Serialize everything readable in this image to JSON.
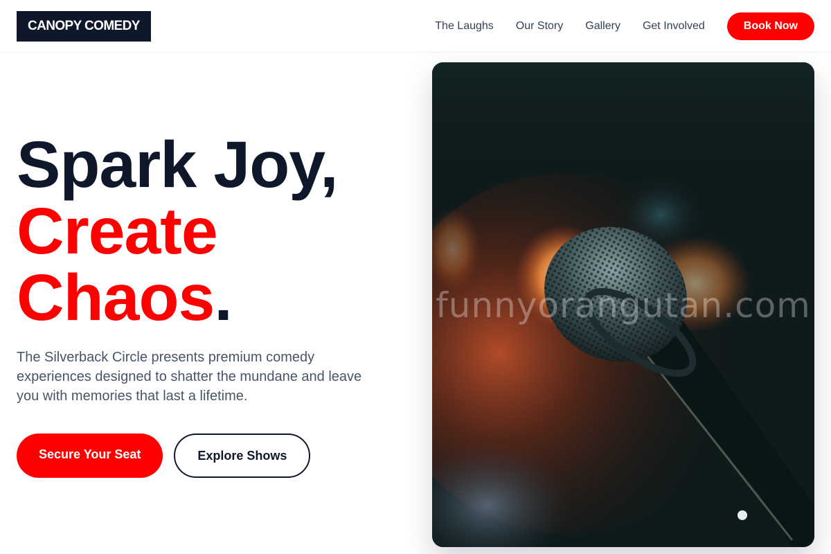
{
  "header": {
    "logo": "CANOPY COMEDY",
    "nav": [
      "The Laughs",
      "Our Story",
      "Gallery",
      "Get Involved"
    ],
    "cta": "Book Now"
  },
  "hero": {
    "title_line1": "Spark Joy,",
    "title_line2": "Create",
    "title_line3": "Chaos",
    "title_period": ".",
    "description": "The Silverback Circle presents premium comedy experiences designed to shatter the mundane and leave you with memories that last a lifetime.",
    "primary_cta": "Secure Your Seat",
    "secondary_cta": "Explore Shows",
    "image_watermark": "funnyorangutan.com"
  },
  "colors": {
    "accent": "#ff0000",
    "dark": "#0f172a",
    "muted_text": "#475569"
  }
}
